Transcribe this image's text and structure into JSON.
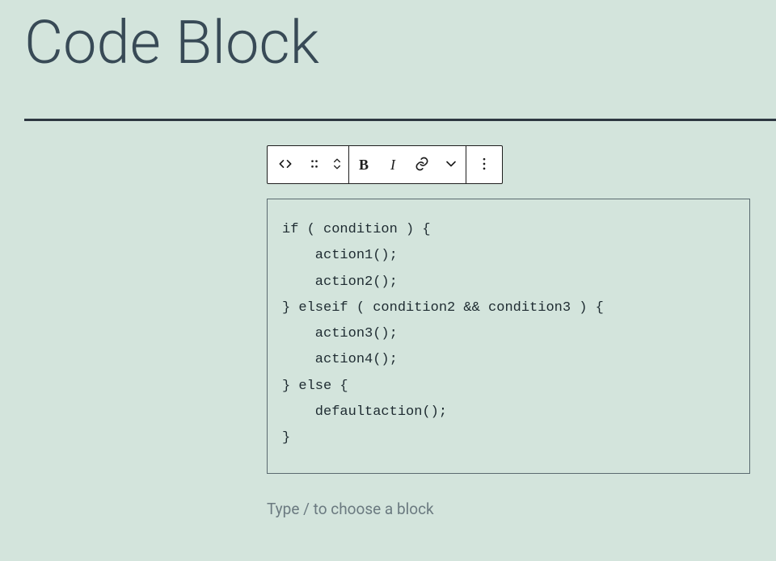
{
  "page": {
    "title": "Code Block"
  },
  "toolbar": {
    "bold_label": "B",
    "italic_label": "I"
  },
  "code": {
    "content": "if ( condition ) {\n    action1();\n    action2();\n} elseif ( condition2 && condition3 ) {\n    action3();\n    action4();\n} else {\n    defaultaction();\n}"
  },
  "prompt": {
    "placeholder": "Type / to choose a block"
  }
}
